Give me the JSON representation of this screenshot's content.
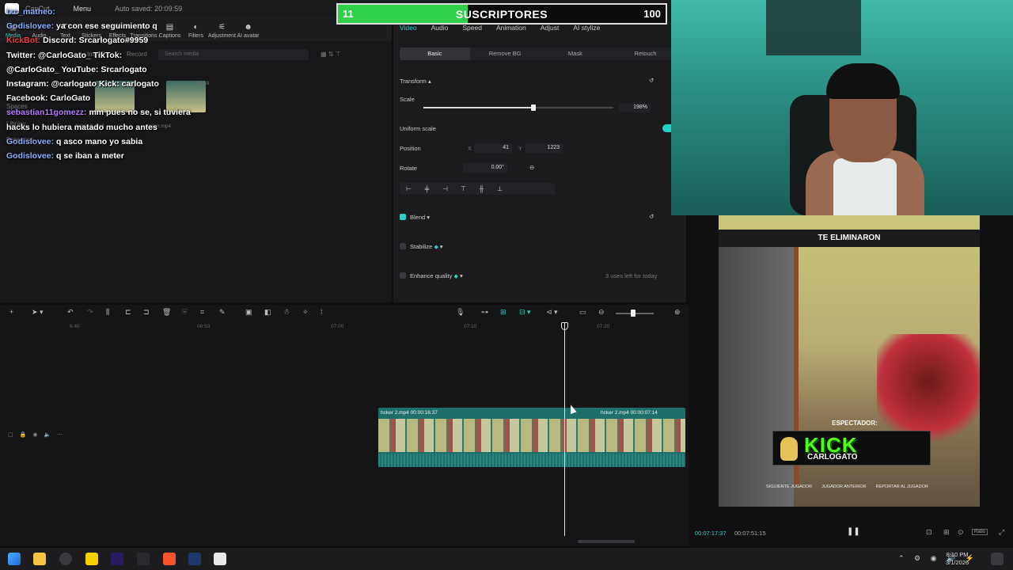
{
  "app": {
    "title": "CapCut",
    "menu_label": "Menu",
    "autosave": "Auto saved: 20:09:59"
  },
  "toolbar": [
    {
      "label": "Media",
      "icon": "media-icon",
      "active": true
    },
    {
      "label": "Audio",
      "icon": "audio-icon"
    },
    {
      "label": "Text",
      "icon": "text-icon"
    },
    {
      "label": "Stickers",
      "icon": "stickers-icon"
    },
    {
      "label": "Effects",
      "icon": "effects-icon"
    },
    {
      "label": "Transitions",
      "icon": "transitions-icon"
    },
    {
      "label": "Captions",
      "icon": "captions-icon"
    },
    {
      "label": "Filters",
      "icon": "filters-icon"
    },
    {
      "label": "Adjustment",
      "icon": "adjustment-icon"
    },
    {
      "label": "AI avatar",
      "icon": "ai-avatar-icon"
    }
  ],
  "media": {
    "import_label": "Import",
    "record_label": "Record",
    "search_placeholder": "Search media",
    "side_items": [
      "Spaces",
      "Library",
      "Dreamina"
    ],
    "files": [
      "hcker 2.mp4",
      "hcker.mp4"
    ],
    "durations": [
      "16:59",
      "07:14"
    ]
  },
  "chat": [
    {
      "user": "txc_matheo:",
      "msg": "",
      "cls": ""
    },
    {
      "user": "Godislovee:",
      "msg": "ya con ese seguimiento q",
      "cls": ""
    },
    {
      "user": "KickBot:",
      "msg": "Discord: Srcarlogato#9959",
      "cls": "kick"
    },
    {
      "user": "",
      "msg": "Twitter: @CarloGato_ TikTok:",
      "cls": ""
    },
    {
      "user": "",
      "msg": "@CarloGato_ YouTube: Srcarlogato",
      "cls": ""
    },
    {
      "user": "",
      "msg": "Instagram: @carlogato Kick: carlogato",
      "cls": ""
    },
    {
      "user": "",
      "msg": "Facebook: CarloGato",
      "cls": ""
    },
    {
      "user": "sebastian11gomezz:",
      "msg": "mm pues no se, si tuviera",
      "cls": "tw"
    },
    {
      "user": "",
      "msg": "hacks lo hubiera matado mucho antes",
      "cls": ""
    },
    {
      "user": "Godislovee:",
      "msg": "q asco mano yo sabia",
      "cls": ""
    },
    {
      "user": "Godislovee:",
      "msg": "q se iban a meter",
      "cls": ""
    }
  ],
  "subs": {
    "title": "SUSCRIPTORES",
    "current": 11,
    "goal": 100,
    "color": "#2fcf4a"
  },
  "props": {
    "tabs": [
      "Video",
      "Audio",
      "Speed",
      "Animation",
      "Adjust",
      "AI stylize"
    ],
    "active_tab": "Video",
    "subtabs": [
      "Basic",
      "Remove BG",
      "Mask",
      "Retouch"
    ],
    "active_subtab": "Basic",
    "transform_label": "Transform",
    "scale_label": "Scale",
    "scale_value": "198%",
    "scale_fraction": 0.33,
    "uniform_scale_label": "Uniform scale",
    "position_label": "Position",
    "pos_x_label": "X",
    "pos_x": "41",
    "pos_y_label": "Y",
    "pos_y": "1223",
    "rotate_label": "Rotate",
    "rotate_value": "0.00°",
    "blend_label": "Blend",
    "stabilize_label": "Stabilize",
    "enhance_label": "Enhance quality",
    "uses_left": "3 uses left for today"
  },
  "timeline": {
    "ruler": [
      "6:40",
      "06:50",
      "07:00",
      "07:10",
      "07:20"
    ],
    "clip_left_label": "hcker 2.mp4  00:00:16:37",
    "clip_right_label": "hcker 2.mp4  00:00:07:14",
    "track_label": "0",
    "zoom_fraction": 0.4
  },
  "preview": {
    "eliminated": "TE ELIMINARON",
    "spectator": "ESPECTADOR:",
    "kick_text": "KICK",
    "kick_name": "CARLOGATO",
    "options": [
      "SIGUIENTE JUGADOR",
      "JUGADOR ANTERIOR",
      "REPORTAR AL JUGADOR"
    ],
    "time_current": "00:07:17:37",
    "time_total": "00:07:51:15",
    "ratio": "Ratio"
  },
  "taskbar": {
    "time": "8:10 PM",
    "date": "3/1/2026"
  }
}
